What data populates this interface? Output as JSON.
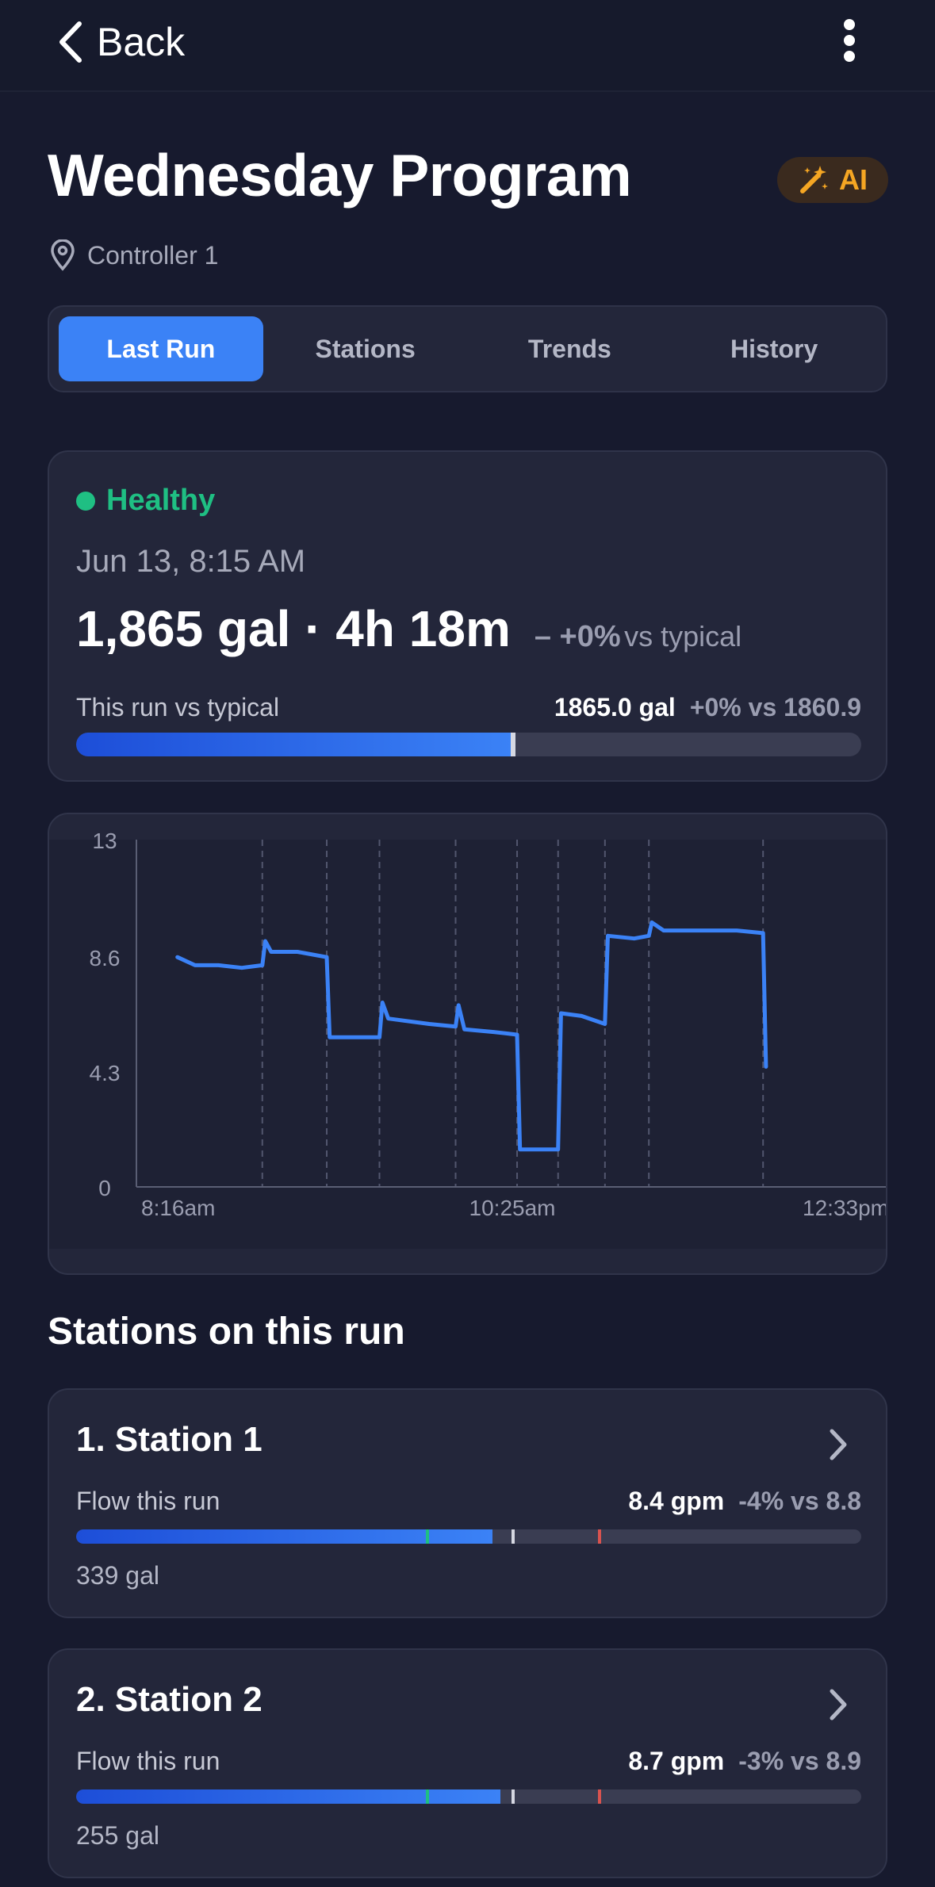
{
  "header": {
    "back_label": "Back"
  },
  "program": {
    "title": "Wednesday Program",
    "ai_badge": "AI",
    "location": "Controller 1"
  },
  "tabs": [
    {
      "label": "Last Run",
      "active": true
    },
    {
      "label": "Stations",
      "active": false
    },
    {
      "label": "Trends",
      "active": false
    },
    {
      "label": "History",
      "active": false
    }
  ],
  "summary": {
    "status": "Healthy",
    "status_color": "#1fbf83",
    "date": "Jun 13, 8:15 AM",
    "total": "1,865 gal · 4h 18m",
    "delta": "– +0%",
    "delta_label": "vs typical",
    "compare_label": "This run vs typical",
    "compare_value": "1865.0 gal",
    "compare_delta": "+0% vs 1860.9",
    "progress_fraction": 0.557
  },
  "chart_data": {
    "type": "line",
    "title": "",
    "xlabel": "",
    "ylabel": "",
    "y_ticks": [
      "13",
      "8.6",
      "4.3",
      "0"
    ],
    "x_ticks": [
      "8:16am",
      "10:25am",
      "12:33pm"
    ],
    "ylim": [
      0,
      13
    ],
    "xlim_minutes": [
      0,
      257
    ],
    "grid": "vertical dashed lines at station boundaries",
    "station_boundaries_minutes": [
      43,
      65,
      83,
      109,
      130,
      144,
      160,
      175,
      214
    ],
    "series": [
      {
        "color": "#3b82f6",
        "points": [
          [
            14,
            8.6
          ],
          [
            20,
            8.3
          ],
          [
            28,
            8.3
          ],
          [
            36,
            8.2
          ],
          [
            43,
            8.3
          ],
          [
            44,
            9.2
          ],
          [
            46,
            8.8
          ],
          [
            55,
            8.8
          ],
          [
            65,
            8.6
          ],
          [
            66,
            5.6
          ],
          [
            75,
            5.6
          ],
          [
            83,
            5.6
          ],
          [
            84,
            6.9
          ],
          [
            86,
            6.3
          ],
          [
            100,
            6.1
          ],
          [
            109,
            6.0
          ],
          [
            110,
            6.8
          ],
          [
            112,
            5.9
          ],
          [
            122,
            5.8
          ],
          [
            130,
            5.7
          ],
          [
            131,
            1.4
          ],
          [
            138,
            1.4
          ],
          [
            144,
            1.4
          ],
          [
            145,
            6.5
          ],
          [
            152,
            6.4
          ],
          [
            160,
            6.1
          ],
          [
            161,
            9.4
          ],
          [
            170,
            9.3
          ],
          [
            175,
            9.4
          ],
          [
            176,
            9.9
          ],
          [
            180,
            9.6
          ],
          [
            195,
            9.6
          ],
          [
            205,
            9.6
          ],
          [
            214,
            9.5
          ],
          [
            215,
            4.5
          ]
        ]
      }
    ]
  },
  "stations_section": {
    "title": "Stations on this run"
  },
  "stations": [
    {
      "name": "1. Station 1",
      "flow_label": "Flow this run",
      "flow_value": "8.4 gpm",
      "flow_delta": "-4% vs 8.8",
      "gallons": "339 gal",
      "fill_fraction": 0.53,
      "green_tick_fraction": 0.447,
      "white_tick_fraction": 0.557,
      "red_tick_fraction": 0.667
    },
    {
      "name": "2. Station 2",
      "flow_label": "Flow this run",
      "flow_value": "8.7 gpm",
      "flow_delta": "-3% vs 8.9",
      "gallons": "255 gal",
      "fill_fraction": 0.54,
      "green_tick_fraction": 0.447,
      "white_tick_fraction": 0.557,
      "red_tick_fraction": 0.667
    }
  ],
  "colors": {
    "background": "#171a2e",
    "card": "#23263a",
    "accent": "#3b82f6",
    "healthy": "#1fbf83",
    "ai": "#f5a623",
    "marker_red": "#d9534f"
  }
}
